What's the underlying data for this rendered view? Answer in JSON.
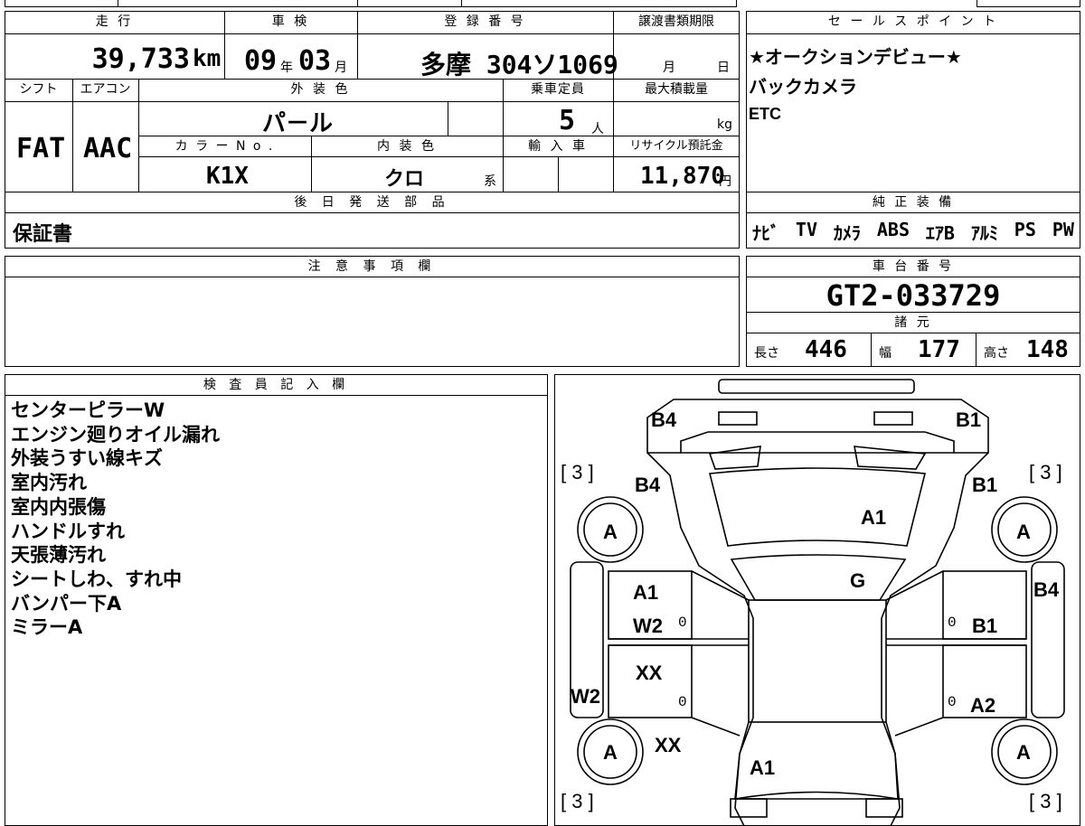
{
  "vehicle": {
    "labels": {
      "mileage": "走 行",
      "inspection": "車 検",
      "registration": "登 録 番 号",
      "transfer_deadline": "譲渡書類期限",
      "shift": "シフト",
      "aircon": "エアコン",
      "exterior_color": "外 装 色",
      "capacity": "乗車定員",
      "max_load": "最大積載量",
      "color_no": "カ ラ ー N o .",
      "interior_color": "内 装 色",
      "import": "輸 入 車",
      "recycle": "リサイクル預託金",
      "later_parts": "後 日 発 送 部 品",
      "notes": "注 意 事 項 欄"
    },
    "mileage": "39,733",
    "mileage_unit": "km",
    "inspection_year": "09",
    "inspection_year_unit": "年",
    "inspection_month": "03",
    "inspection_month_unit": "月",
    "plate": "多摩 304ソ1069",
    "deadline_month_unit": "月",
    "deadline_day_unit": "日",
    "shift": "FAT",
    "aircon": "AAC",
    "exterior_color": "パ－ル",
    "capacity": "5",
    "capacity_unit": "人",
    "max_load_unit": "kg",
    "color_no": "K1X",
    "interior_color": "クロ",
    "interior_suffix": "系",
    "recycle_fee": "11,870",
    "recycle_unit": "円",
    "later_parts": "保証書",
    "notes": ""
  },
  "sales": {
    "label": "セ ー ル ス ポ イ ン ト",
    "lines": [
      "★オークションデビュー★",
      "バックカメラ",
      "ETC"
    ]
  },
  "equipment": {
    "label": "純 正 装 備",
    "items": [
      "ﾅﾋﾞ",
      "TV",
      "ｶﾒﾗ",
      "ABS",
      "ｴｱB",
      "ｱﾙﾐ",
      "PS",
      "PW"
    ]
  },
  "chassis": {
    "label": "車 台 番 号",
    "number": "GT2-033729",
    "spec_label": "諸 元",
    "length_label": "長さ",
    "length": "446",
    "width_label": "幅",
    "width": "177",
    "height_label": "高さ",
    "height": "148"
  },
  "inspector": {
    "label": "検 査 員 記 入 欄",
    "lines": [
      "センターピラーW",
      "エンジン廻りオイル漏れ",
      "外装うすい線キズ",
      "室内汚れ",
      "室内内張傷",
      "ハンドルすれ",
      "天張薄汚れ",
      "シートしわ、すれ中",
      "バンパー下A",
      "ミラーA"
    ]
  },
  "diagram": {
    "marks": {
      "rear_left": "B4",
      "rear_right": "B1",
      "tire_count_rl": "[ 3 ]",
      "tire_count_rr": "[ 3 ]",
      "tire_count_fl": "[ 3 ]",
      "tire_count_fr": "[ 3 ]",
      "rear_quarter_left": "B4",
      "rear_quarter_right": "B1",
      "rear_glass": "A1",
      "roof": "G",
      "tire_rl": "A",
      "tire_rr": "A",
      "tire_fl": "A",
      "tire_fr": "A",
      "rear_door_left_1": "A1",
      "rear_door_left_2": "W2",
      "front_door_left": "XX",
      "front_fender_left": "XX",
      "side_left": "W2",
      "side_right": "B4",
      "rear_door_right": "B1",
      "front_door_right": "A2",
      "hood": "A1",
      "zero": "0"
    }
  }
}
